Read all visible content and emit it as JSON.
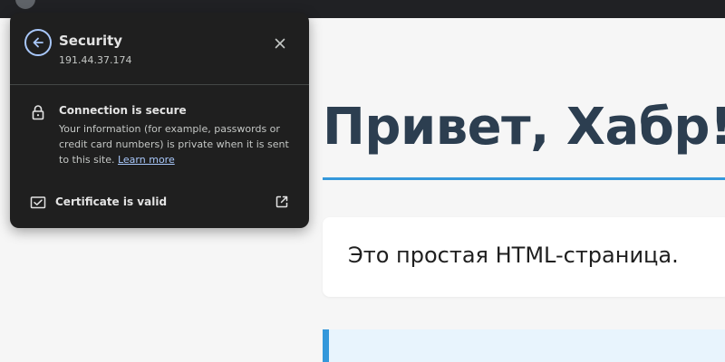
{
  "page": {
    "heading": "Привет, Хабр!",
    "content_text": "Это простая HTML-страница."
  },
  "security_popup": {
    "title": "Security",
    "ip_address": "191.44.37.174",
    "connection_title": "Connection is secure",
    "connection_description": "Your information (for example, passwords or credit card numbers) is private when it is sent to this site.",
    "learn_more_link": "Learn more",
    "certificate_label": "Certificate is valid"
  },
  "icons": {
    "back": "back-arrow-icon",
    "close": "close-icon",
    "lock": "lock-icon",
    "certificate": "certificate-icon",
    "external": "external-link-icon"
  },
  "colors": {
    "popup_background": "#1f1f1f",
    "popup_text": "#e3e3e3",
    "popup_secondary_text": "#c4c7c5",
    "link_accent": "#a8c7fa",
    "page_background": "#f6f6f6",
    "heading": "#2c3e50",
    "accent_blue": "#3498db",
    "info_box_background": "#e8f4fd"
  }
}
